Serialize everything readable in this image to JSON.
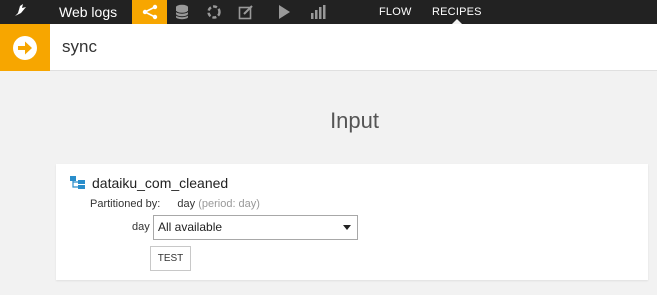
{
  "topbar": {
    "project_name": "Web logs",
    "nav_icons": [
      "flow-icon",
      "datasets-icon",
      "recipes-icon",
      "notebooks-icon",
      "jobs-icon",
      "dashboards-icon"
    ],
    "links": [
      {
        "label": "FLOW",
        "active": false
      },
      {
        "label": "RECIPES",
        "active": true
      }
    ]
  },
  "recipe": {
    "name": "sync",
    "icon": "arrow-right-icon"
  },
  "section": {
    "title": "Input"
  },
  "input": {
    "dataset_name": "dataiku_com_cleaned",
    "partitioned_by_label": "Partitioned by:",
    "partition_dimension": "day",
    "partition_note": "(period: day)",
    "dimension_label": "day",
    "select_value": "All available",
    "test_label": "TEST"
  },
  "colors": {
    "accent": "#f7a600",
    "topbar_bg": "#222222",
    "dataset_icon": "#2a8ecb"
  }
}
